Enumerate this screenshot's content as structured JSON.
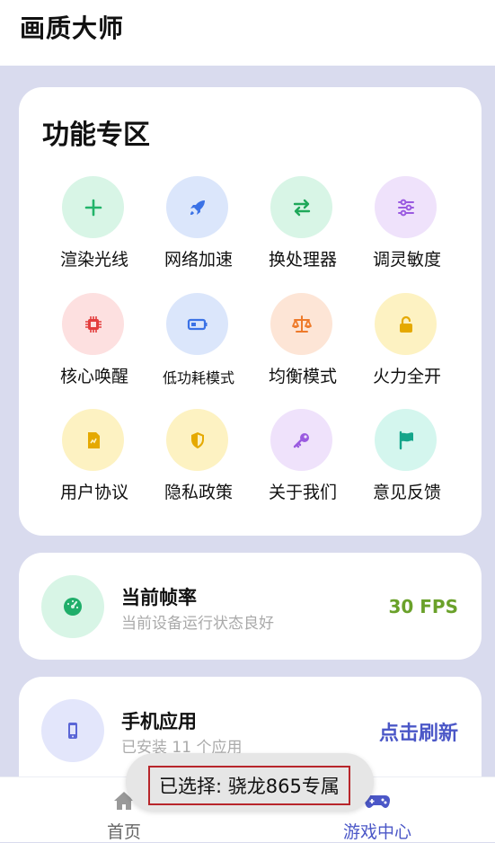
{
  "header": {
    "title": "画质大师"
  },
  "features": {
    "heading": "功能专区",
    "items": [
      {
        "label": "渲染光线",
        "icon": "plus-icon",
        "bg": "#d8f5e6",
        "fg": "#22b46a"
      },
      {
        "label": "网络加速",
        "icon": "rocket-icon",
        "bg": "#dbe6fb",
        "fg": "#3b72e6"
      },
      {
        "label": "换处理器",
        "icon": "swap-arrows-icon",
        "bg": "#d8f5e6",
        "fg": "#1fa85a"
      },
      {
        "label": "调灵敏度",
        "icon": "sliders-icon",
        "bg": "#efe2fb",
        "fg": "#9a5ae0"
      },
      {
        "label": "核心唤醒",
        "icon": "chip-icon",
        "bg": "#fde0e0",
        "fg": "#e33d3d"
      },
      {
        "label": "低功耗模式",
        "icon": "battery-icon",
        "bg": "#dbe6fb",
        "fg": "#3b72e6"
      },
      {
        "label": "均衡模式",
        "icon": "scale-icon",
        "bg": "#fde5d6",
        "fg": "#ee7a2a"
      },
      {
        "label": "火力全开",
        "icon": "unlock-icon",
        "bg": "#fdf2c2",
        "fg": "#e5a900"
      },
      {
        "label": "用户协议",
        "icon": "document-icon",
        "bg": "#fdf2c2",
        "fg": "#e5a900"
      },
      {
        "label": "隐私政策",
        "icon": "shield-icon",
        "bg": "#fdf2c2",
        "fg": "#e5a900"
      },
      {
        "label": "关于我们",
        "icon": "key-icon",
        "bg": "#efe2fb",
        "fg": "#9a5ae0"
      },
      {
        "label": "意见反馈",
        "icon": "flag-icon",
        "bg": "#d4f6ee",
        "fg": "#14a58a"
      }
    ]
  },
  "fps": {
    "title": "当前帧率",
    "subtitle": "当前设备运行状态良好",
    "value": "30 FPS",
    "icon": "gauge-icon"
  },
  "apps": {
    "title": "手机应用",
    "subtitle": "已安装 11 个应用",
    "action": "点击刷新",
    "icon": "phone-icon"
  },
  "nav": {
    "home": "首页",
    "game_center": "游戏中心"
  },
  "toast": {
    "text": "已选择: 骁龙865专属"
  },
  "colors": {
    "accent": "#4b57c7",
    "fps_green": "#6aa12a",
    "background": "#d9dbee"
  }
}
